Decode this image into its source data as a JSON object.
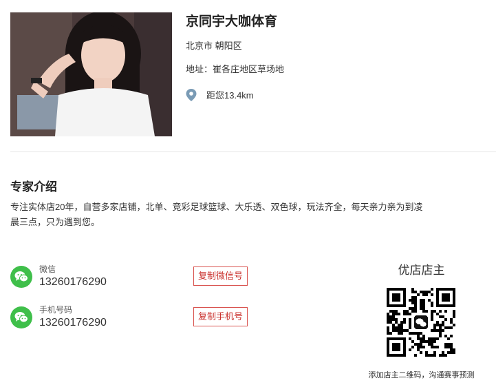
{
  "shop": {
    "name": "京同宇大咖体育",
    "city": "北京市 朝阳区",
    "address": "地址：崔各庄地区草场地",
    "distance": "距您13.4km"
  },
  "intro": {
    "title": "专家介绍",
    "text": "专注实体店20年，自营多家店铺，北单、竞彩足球篮球、大乐透、双色球，玩法齐全，每天亲力亲为到凌晨三点，只为遇到您。"
  },
  "contacts": [
    {
      "label": "微信",
      "value": "13260176290",
      "button": "复制微信号"
    },
    {
      "label": "手机号码",
      "value": "13260176290",
      "button": "复制手机号"
    }
  ],
  "qr": {
    "title": "优店店主",
    "caption": "添加店主二维码，沟通赛事预测"
  },
  "colors": {
    "wechat_green": "#3fbf4a",
    "button_red": "#d9534f",
    "pin_blue": "#7a9bb5"
  },
  "icons": {
    "location": "location-pin-icon",
    "wechat": "wechat-icon"
  }
}
